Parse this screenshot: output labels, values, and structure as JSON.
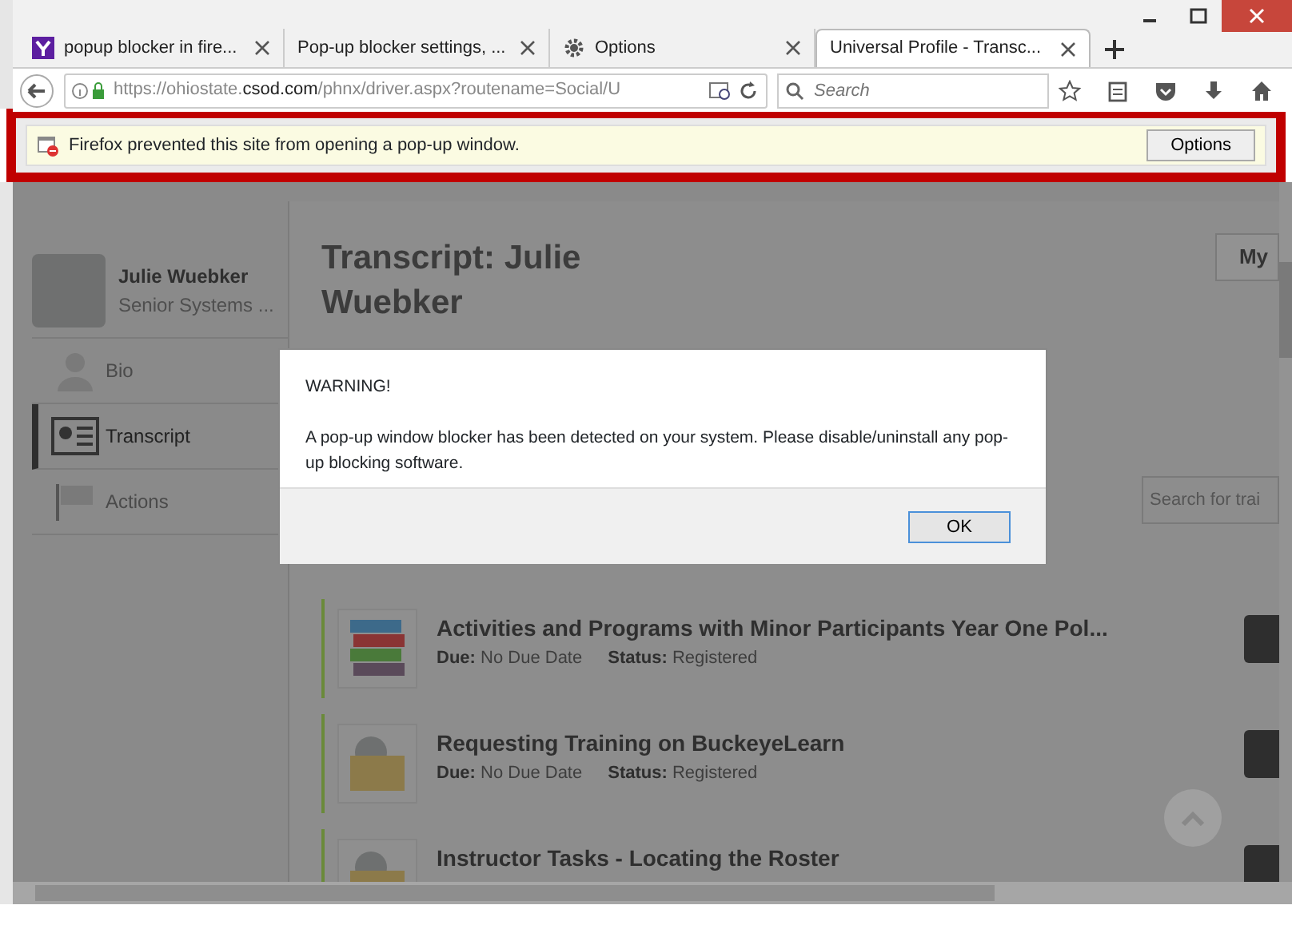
{
  "tabs": [
    {
      "kind": "yahoo",
      "label": "popup blocker in fire...",
      "selected": false
    },
    {
      "kind": "plain",
      "label": "Pop-up blocker settings, ...",
      "selected": false
    },
    {
      "kind": "settings",
      "label": "Options",
      "selected": false
    },
    {
      "kind": "plain",
      "label": "Universal Profile - Transc...",
      "selected": true
    }
  ],
  "address": {
    "url": "https://ohiostate.**csod.com**/phnx/driver.aspx?routename=Social/U"
  },
  "search": {
    "placeholder": "Search"
  },
  "notification": {
    "text": "Firefox prevented this site from opening a pop-up window.",
    "button": "Options"
  },
  "profile": {
    "name": "Julie Wuebker",
    "title": "Senior Systems ..."
  },
  "nav": [
    {
      "kind": "person",
      "label": "Bio",
      "selected": false
    },
    {
      "kind": "transcript",
      "label": "Transcript",
      "selected": true
    },
    {
      "kind": "flag",
      "label": "Actions",
      "selected": false
    }
  ],
  "heading": "Transcript: Julie Wuebker",
  "top_button": "My",
  "training_search": {
    "placeholder": "Search for trai"
  },
  "items": [
    {
      "kind": "books",
      "title": "Activities and Programs with Minor Participants Year One Pol...",
      "due_label": "Due:",
      "due": "No Due Date",
      "status_label": "Status:",
      "status": "Registered"
    },
    {
      "kind": "folder",
      "title": "Requesting Training on BuckeyeLearn",
      "due_label": "Due:",
      "due": "No Due Date",
      "status_label": "Status:",
      "status": "Registered"
    },
    {
      "kind": "folder",
      "title": "Instructor Tasks - Locating the Roster"
    }
  ],
  "dialog": {
    "title": "WARNING!",
    "message": "A pop-up window blocker has been detected on your system.  Please disable/uninstall any pop-up blocking software.",
    "button": "OK"
  }
}
